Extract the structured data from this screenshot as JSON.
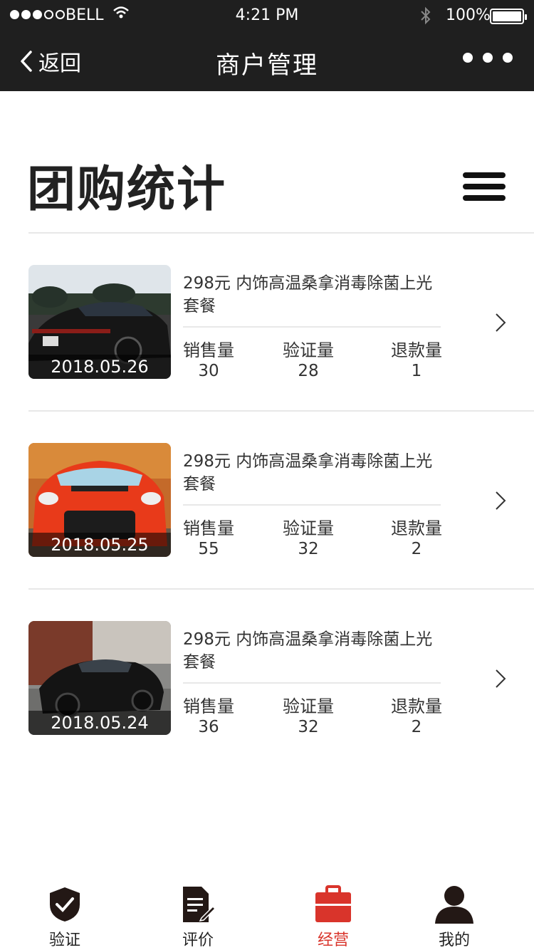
{
  "status_bar": {
    "carrier": "BELL",
    "time": "4:21 PM",
    "battery": "100%"
  },
  "nav": {
    "back_label": "返回",
    "title": "商户管理"
  },
  "page": {
    "heading": "团购统计"
  },
  "stat_labels": {
    "sales": "销售量",
    "verified": "验证量",
    "refund": "退款量"
  },
  "items": [
    {
      "title": "298元 内饰高温桑拿消毒除菌上光套餐",
      "date": "2018.05.26",
      "sales": "30",
      "verified": "28",
      "refund": "1"
    },
    {
      "title": "298元 内饰高温桑拿消毒除菌上光套餐",
      "date": "2018.05.25",
      "sales": "55",
      "verified": "32",
      "refund": "2"
    },
    {
      "title": "298元 内饰高温桑拿消毒除菌上光套餐",
      "date": "2018.05.24",
      "sales": "36",
      "verified": "32",
      "refund": "2"
    }
  ],
  "tabs": [
    {
      "label": "验证",
      "icon": "shield-check-icon"
    },
    {
      "label": "评价",
      "icon": "document-pen-icon"
    },
    {
      "label": "经营",
      "icon": "briefcase-icon",
      "active": true
    },
    {
      "label": "我的",
      "icon": "user-icon"
    }
  ],
  "colors": {
    "accent": "#d9342b",
    "topbar": "#1f1f1f"
  }
}
